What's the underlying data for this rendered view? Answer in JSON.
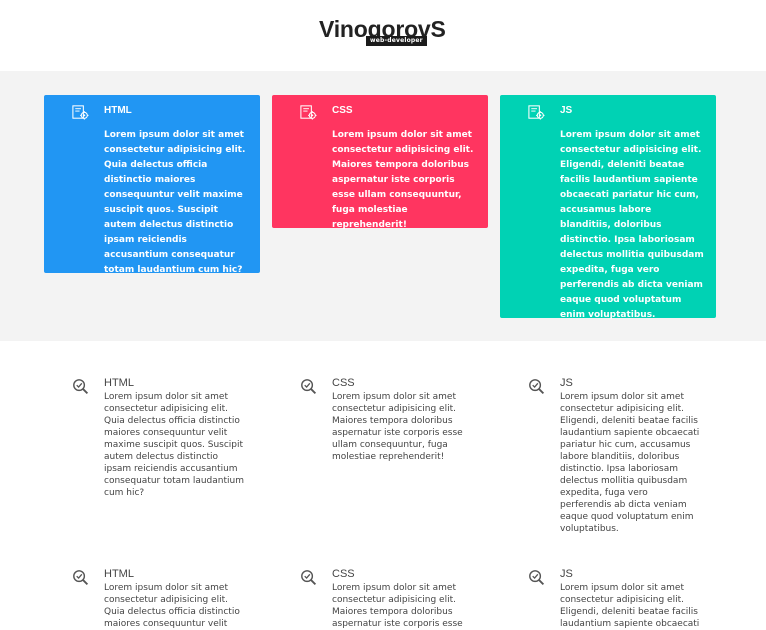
{
  "header": {
    "logo_text": "VinogorovS",
    "logo_tagline": "web-developer"
  },
  "colors": {
    "html_card": "#2196f3",
    "css_card": "#ff3560",
    "js_card": "#00d2b4",
    "band_bg": "#f3f3f3"
  },
  "cards": [
    {
      "title": "HTML",
      "icon": "code-settings-icon",
      "text": "Lorem ipsum dolor sit amet consectetur adipisicing elit. Quia delectus officia distinctio maiores consequuntur velit maxime suscipit quos. Suscipit autem delectus distinctio ipsam reiciendis accusantium consequatur totam laudantium cum hic?"
    },
    {
      "title": "CSS",
      "icon": "code-settings-icon",
      "text": "Lorem ipsum dolor sit amet consectetur adipisicing elit. Maiores tempora doloribus aspernatur iste corporis esse ullam consequuntur, fuga molestiae reprehenderit!"
    },
    {
      "title": "JS",
      "icon": "code-settings-icon",
      "text": "Lorem ipsum dolor sit amet consectetur adipisicing elit. Eligendi, deleniti beatae facilis laudantium sapiente obcaecati pariatur hic cum, accusamus labore blanditiis, doloribus distinctio. Ipsa laboriosam delectus mollitia quibusdam expedita, fuga vero perferendis ab dicta veniam eaque quod voluptatum enim voluptatibus."
    }
  ],
  "features_row1": [
    {
      "title": "HTML",
      "icon": "search-check-icon",
      "text": "Lorem ipsum dolor sit amet consectetur adipisicing elit. Quia delectus officia distinctio maiores consequuntur velit maxime suscipit quos. Suscipit autem delectus distinctio ipsam reiciendis accusantium consequatur totam laudantium cum hic?"
    },
    {
      "title": "CSS",
      "icon": "search-check-icon",
      "text": "Lorem ipsum dolor sit amet consectetur adipisicing elit. Maiores tempora doloribus aspernatur iste corporis esse ullam consequuntur, fuga molestiae reprehenderit!"
    },
    {
      "title": "JS",
      "icon": "search-check-icon",
      "text": "Lorem ipsum dolor sit amet consectetur adipisicing elit. Eligendi, deleniti beatae facilis laudantium sapiente obcaecati pariatur hic cum, accusamus labore blanditiis, doloribus distinctio. Ipsa laboriosam delectus mollitia quibusdam expedita, fuga vero perferendis ab dicta veniam eaque quod voluptatum enim voluptatibus."
    }
  ],
  "features_row2": [
    {
      "title": "HTML",
      "icon": "search-check-icon",
      "text": "Lorem ipsum dolor sit amet consectetur adipisicing elit. Quia delectus officia distinctio maiores consequuntur velit"
    },
    {
      "title": "CSS",
      "icon": "search-check-icon",
      "text": "Lorem ipsum dolor sit amet consectetur adipisicing elit. Maiores tempora doloribus aspernatur iste corporis esse"
    },
    {
      "title": "JS",
      "icon": "search-check-icon",
      "text": "Lorem ipsum dolor sit amet consectetur adipisicing elit. Eligendi, deleniti beatae facilis laudantium sapiente obcaecati"
    }
  ]
}
